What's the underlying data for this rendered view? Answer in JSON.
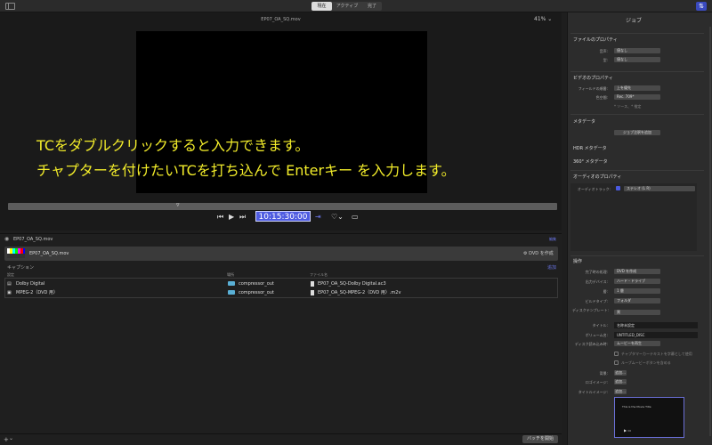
{
  "topbar": {
    "tabs": [
      "現在",
      "アクティブ",
      "完了"
    ]
  },
  "viewer": {
    "clip_title": "EP07_OA_SQ.mov",
    "zoom": "41%",
    "zoom_chevron": "⌄",
    "timecode": "10:15:30:00",
    "scrub_marker": "▿"
  },
  "captions": {
    "line1": "TCをダブルクリックすると入力できます。",
    "line2": "チャプターを付けたいTCを打ち込んで Enterキー を入力します。"
  },
  "batch": {
    "header_file": "EP07_OA_SQ.mov",
    "header_action": "編集",
    "job_name": "EP07_OA_SQ.mov",
    "job_target": "DVD を作成",
    "settings_caption": "キャプション",
    "settings_right_label": "追加",
    "columns": {
      "setting": "設定",
      "location": "場所",
      "filename": "ファイル名"
    },
    "rows": [
      {
        "setting": "Dolby Digital",
        "location": "compressor_out",
        "filename": "EP07_OA_SQ-Dolby Digital.ac3"
      },
      {
        "setting": "MPEG-2（DVD 用）",
        "location": "compressor_out",
        "filename": "EP07_OA_SQ-MPEG-2（DVD 用）.m2v"
      }
    ],
    "start_button": "バッチを開始",
    "add_button": "+",
    "add_chevron": "⌄"
  },
  "inspector": {
    "title": "ジョブ",
    "file_props": {
      "title": "ファイルのプロパティ",
      "row1_label": "音声:",
      "row1_value": "値なし",
      "row2_label": "型:",
      "row2_value": "値なし"
    },
    "video_props": {
      "title": "ビデオのプロパティ",
      "field_label": "フィールドの順番:",
      "field_value": "上を優先",
      "color_label": "色空間:",
      "color_value": "Rec. 709*",
      "note": "* ソース、* 推定"
    },
    "metadata": {
      "title": "メタデータ",
      "button": "ジョブ注釈を追加"
    },
    "hdr": "HDR メタデータ",
    "deg360": "360° メタデータ",
    "audio": {
      "title": "オーディオのプロパティ",
      "track_label": "オーディオトラック:",
      "track_value": "ステレオ (L R)"
    },
    "ops": {
      "title": "操作",
      "rows": [
        {
          "label": "完了時の処理:",
          "value": "DVD を作成"
        },
        {
          "label": "出力デバイス:",
          "value": "ハード・ドライブ"
        },
        {
          "label": "層:",
          "value": "1 層"
        },
        {
          "label": "ビルドタイプ:",
          "value": "フォルダ"
        },
        {
          "label": "ディスクテンプレート:",
          "value": "黒"
        }
      ],
      "disc_title_label": "タイトル:",
      "disc_title_value": "名称未設定",
      "volume_label": "ボリューム名:",
      "volume_value": "UNTITLED_DISC",
      "autoplay_label": "ディスク読み込み時:",
      "autoplay_value": "ムービーを再生",
      "chk1": "チャプタマーカーテキストを字幕として使用",
      "chk2": "ループムービーボタンを含める",
      "bg_label": "背景:",
      "logo_label": "ロゴイメージ:",
      "title_image_label": "タイトルイメージ:",
      "add_label": "追加...",
      "preview_text": "This is the Movie Title"
    }
  }
}
